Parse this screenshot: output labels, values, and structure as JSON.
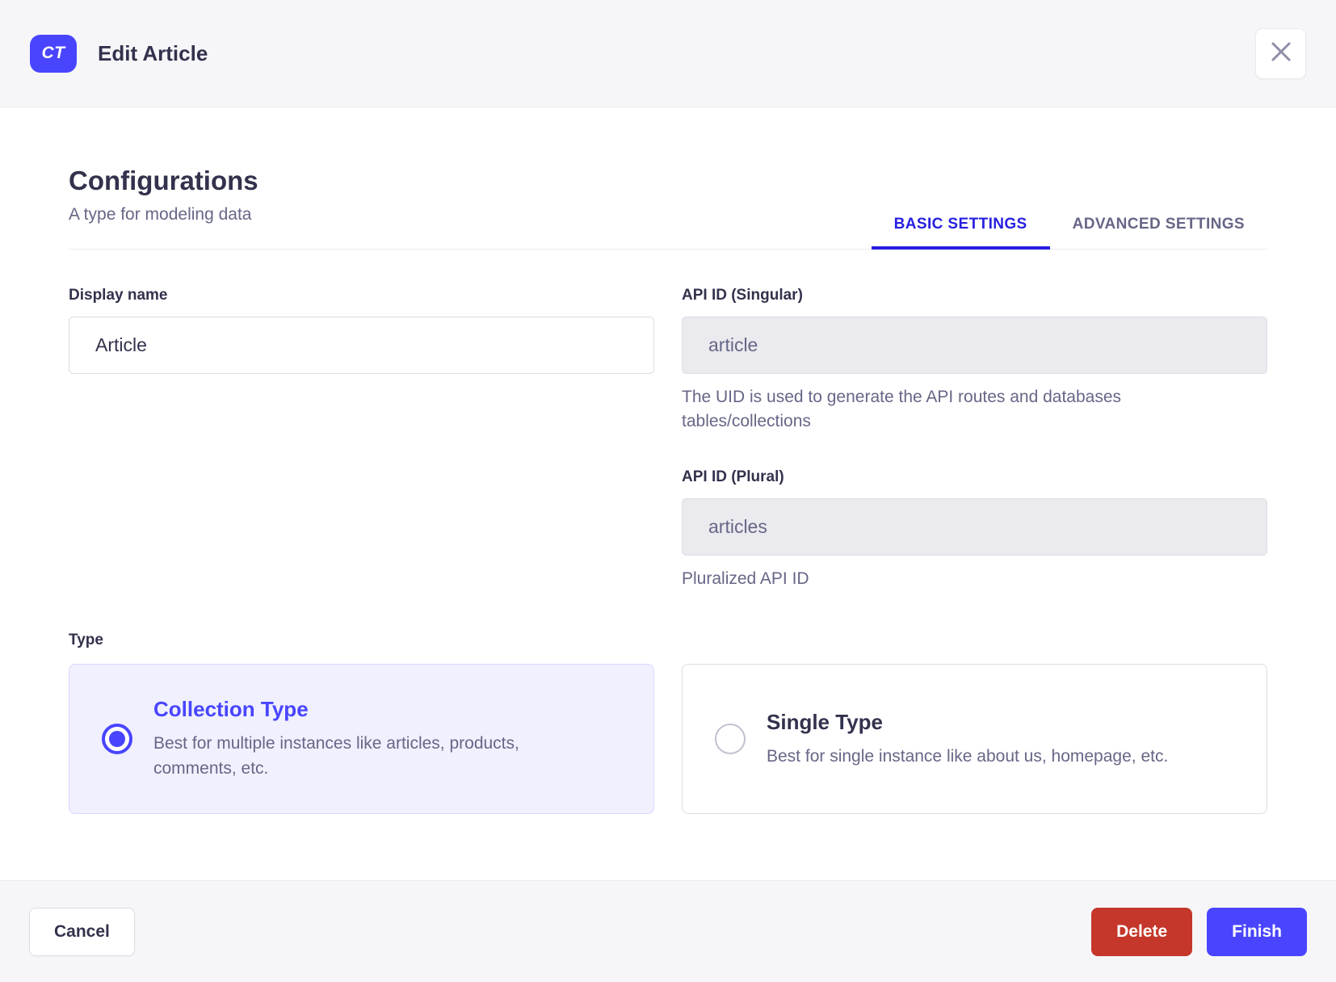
{
  "header": {
    "badge": "CT",
    "title": "Edit Article"
  },
  "config": {
    "title": "Configurations",
    "subtitle": "A type for modeling data"
  },
  "tabs": [
    {
      "label": "BASIC SETTINGS",
      "active": true
    },
    {
      "label": "ADVANCED SETTINGS",
      "active": false
    }
  ],
  "form": {
    "display_name": {
      "label": "Display name",
      "value": "Article"
    },
    "api_id_singular": {
      "label": "API ID (Singular)",
      "value": "article",
      "hint": "The UID is used to generate the API routes and databases tables/collections"
    },
    "api_id_plural": {
      "label": "API ID (Plural)",
      "value": "articles",
      "hint": "Pluralized API ID"
    },
    "type": {
      "label": "Type",
      "options": [
        {
          "title": "Collection Type",
          "description": "Best for multiple instances like articles, products, comments, etc.",
          "selected": true
        },
        {
          "title": "Single Type",
          "description": "Best for single instance like about us, homepage, etc.",
          "selected": false
        }
      ]
    }
  },
  "footer": {
    "cancel": "Cancel",
    "delete": "Delete",
    "finish": "Finish"
  },
  "colors": {
    "primary": "#4945ff",
    "tab_active": "#271fe0",
    "danger": "#c4372a",
    "selected_card_bg": "#f0f0ff",
    "surface": "#f6f6f9",
    "border": "#eaeaef",
    "input_border": "#dcdce4",
    "text_dark": "#32324d",
    "text_muted": "#666687"
  }
}
